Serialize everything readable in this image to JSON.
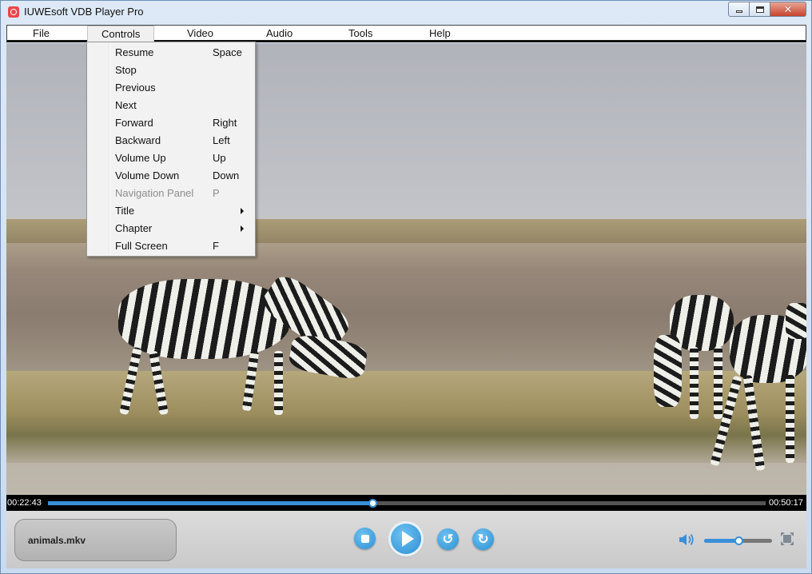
{
  "window": {
    "title": "IUWEsoft VDB Player Pro"
  },
  "menubar": {
    "items": [
      "File",
      "Controls",
      "Video",
      "Audio",
      "Tools",
      "Help"
    ]
  },
  "controls_menu": {
    "items": [
      {
        "label": "Resume",
        "shortcut": "Space"
      },
      {
        "label": "Stop",
        "shortcut": ""
      },
      {
        "label": "Previous",
        "shortcut": ""
      },
      {
        "label": "Next",
        "shortcut": ""
      },
      {
        "label": "Forward",
        "shortcut": "Right"
      },
      {
        "label": "Backward",
        "shortcut": "Left"
      },
      {
        "label": "Volume Up",
        "shortcut": "Up"
      },
      {
        "label": "Volume Down",
        "shortcut": "Down"
      },
      {
        "label": "Navigation Panel",
        "shortcut": "P"
      },
      {
        "label": "Title",
        "shortcut": ""
      },
      {
        "label": "Chapter",
        "shortcut": ""
      },
      {
        "label": "Full Screen",
        "shortcut": "F"
      }
    ]
  },
  "player": {
    "current_time": "00:22:43",
    "total_time": "00:50:17",
    "progress_fraction": 0.452,
    "file_name": "animals.mkv",
    "volume_fraction": 0.5
  },
  "colors": {
    "accent": "#3a8fd9",
    "menu_bg": "#f2f2f2",
    "disabled_text": "#8d8d8d"
  },
  "icons": [
    "stop-icon",
    "play-icon",
    "rewind-icon",
    "forward-icon",
    "volume-icon",
    "fullscreen-icon"
  ]
}
